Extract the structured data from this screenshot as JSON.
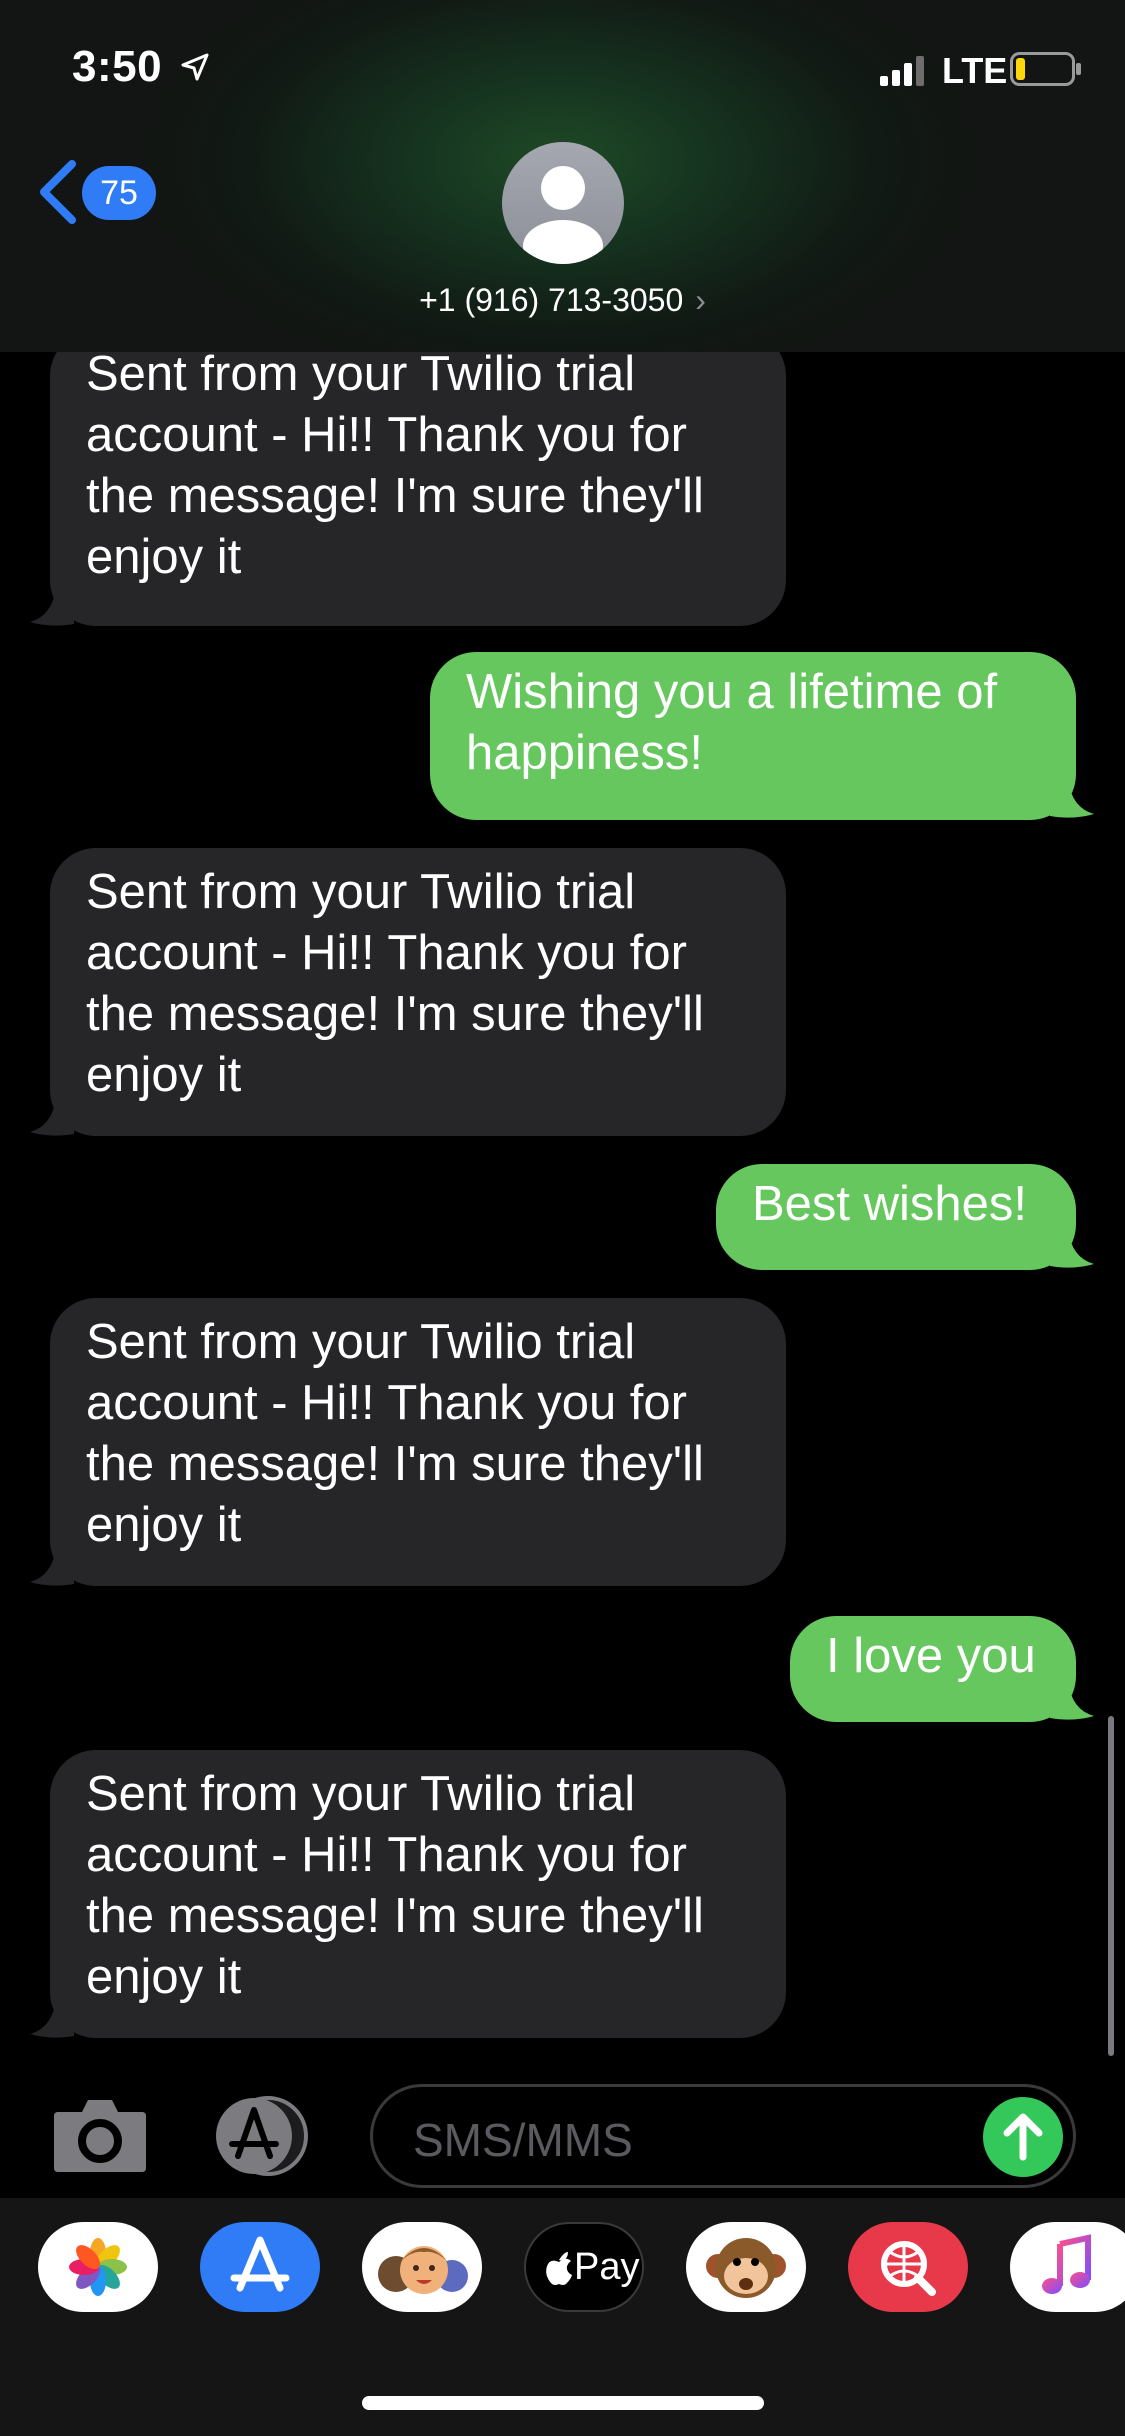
{
  "status_bar": {
    "time": "3:50",
    "network": "LTE"
  },
  "header": {
    "back_count": "75",
    "contact": "+1 (916) 713-3050",
    "contact_chevron": "›"
  },
  "messages": [
    {
      "direction": "incoming",
      "text": "Sent from your Twilio trial account - Hi!! Thank you for the message! I'm sure they'll enjoy it"
    },
    {
      "direction": "outgoing",
      "text": "Wishing you a lifetime of happiness!"
    },
    {
      "direction": "incoming",
      "text": "Sent from your Twilio trial account - Hi!! Thank you for the message! I'm sure they'll enjoy it"
    },
    {
      "direction": "outgoing",
      "text": "Best wishes!"
    },
    {
      "direction": "incoming",
      "text": "Sent from your Twilio trial account - Hi!! Thank you for the message! I'm sure they'll enjoy it"
    },
    {
      "direction": "outgoing",
      "text": "I love you"
    },
    {
      "direction": "incoming",
      "text": "Sent from your Twilio trial account - Hi!! Thank you for the message! I'm sure they'll enjoy it"
    }
  ],
  "composer": {
    "placeholder": "SMS/MMS"
  },
  "app_drawer": {
    "apps": [
      {
        "icon": "photos-icon"
      },
      {
        "icon": "app-store-icon"
      },
      {
        "icon": "memoji-stickers-icon"
      },
      {
        "icon": "apple-pay-icon",
        "label": "Pay"
      },
      {
        "icon": "animoji-icon"
      },
      {
        "icon": "web-images-search-icon"
      },
      {
        "icon": "music-icon"
      }
    ]
  },
  "colors": {
    "incoming_bubble": "#262628",
    "outgoing_bubble": "#66c75f",
    "accent_blue": "#2f7cf6",
    "send_green": "#34c759"
  }
}
